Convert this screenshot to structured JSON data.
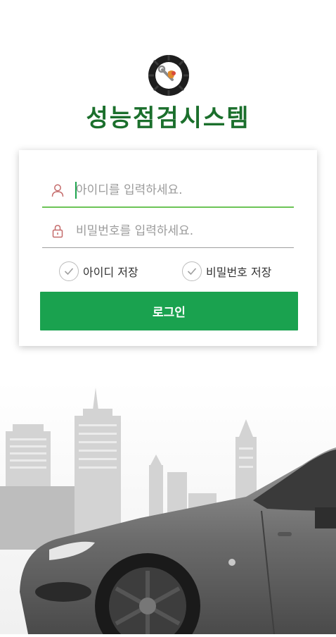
{
  "app": {
    "title": "성능점검시스템",
    "logo_icon": "tire-wrench-logo"
  },
  "login": {
    "id_placeholder": "아이디를 입력하세요.",
    "password_placeholder": "비밀번호를 입력하세요.",
    "user_icon": "user-icon",
    "lock_icon": "lock-icon",
    "save_id_label": "아이디 저장",
    "save_password_label": "비밀번호 저장",
    "save_id_checked": false,
    "save_password_checked": false,
    "login_button_label": "로그인"
  },
  "background": {
    "image": "city-skyline-with-gray-sports-car"
  },
  "colors": {
    "brand_green": "#1aa24f",
    "title_green": "#1b6f2c",
    "active_underline": "#6cc456",
    "user_icon": "#c46b6b"
  }
}
